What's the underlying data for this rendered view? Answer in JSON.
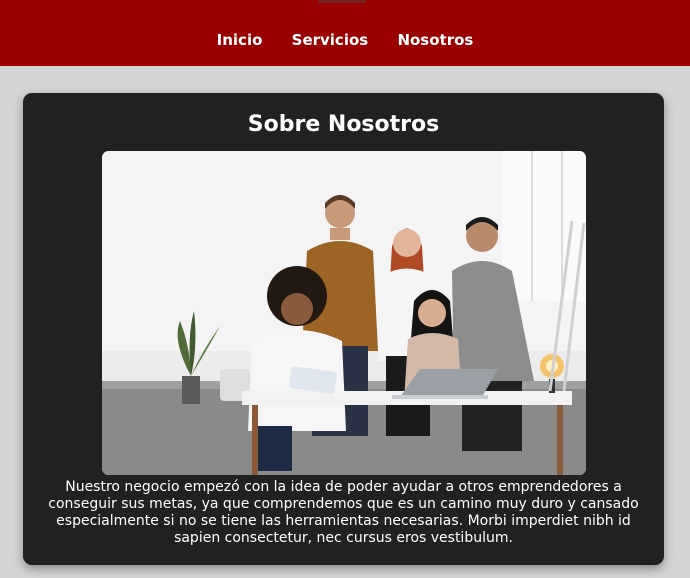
{
  "nav": {
    "items": [
      "Inicio",
      "Servicios",
      "Nosotros"
    ]
  },
  "about": {
    "title": "Sobre Nosotros",
    "photo_icon": "team-photo",
    "paragraph": "Nuestro negocio empezó con la idea de poder ayudar a otros emprendedores a conseguir sus metas, ya que comprendemos que es un camino muy duro y cansado especialmente si no se tiene las herramientas necesarias. Morbi imperdiet nibh id sapien consectetur, nec cursus eros vestibulum."
  },
  "colors": {
    "header": "#9a0000",
    "card": "#212121",
    "page": "#d4d4d4"
  }
}
